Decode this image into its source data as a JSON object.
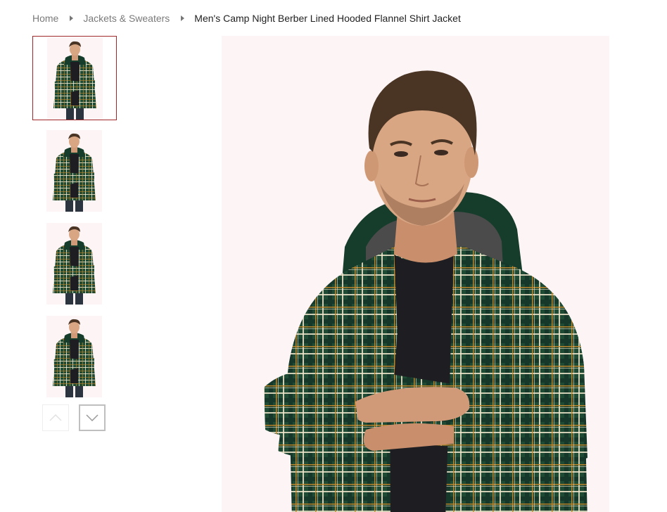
{
  "breadcrumb": {
    "home": "Home",
    "category": "Jackets & Sweaters",
    "current": "Men's Camp Night Berber Lined Hooded Flannel Shirt Jacket"
  },
  "gallery": {
    "thumbnails": [
      {
        "name": "thumb-1",
        "pose": "arms-crossed",
        "active": true
      },
      {
        "name": "thumb-2",
        "pose": "arms-crossed-front",
        "active": false
      },
      {
        "name": "thumb-3",
        "pose": "hands-in-pockets",
        "active": false
      },
      {
        "name": "thumb-4",
        "pose": "arms-crossed-side",
        "active": false
      }
    ],
    "nav": {
      "up_icon": "chevron-up-icon",
      "down_icon": "chevron-down-icon"
    }
  },
  "colors": {
    "accent": "#a0282a",
    "image_bg": "#fdf4f5",
    "flannel_green": "#1f4a34",
    "plaid_cream": "#efe6cc",
    "plaid_mustard": "#c98a2a",
    "tee": "#1e1e22",
    "skin": "#d9a684",
    "hair": "#4a3424"
  }
}
